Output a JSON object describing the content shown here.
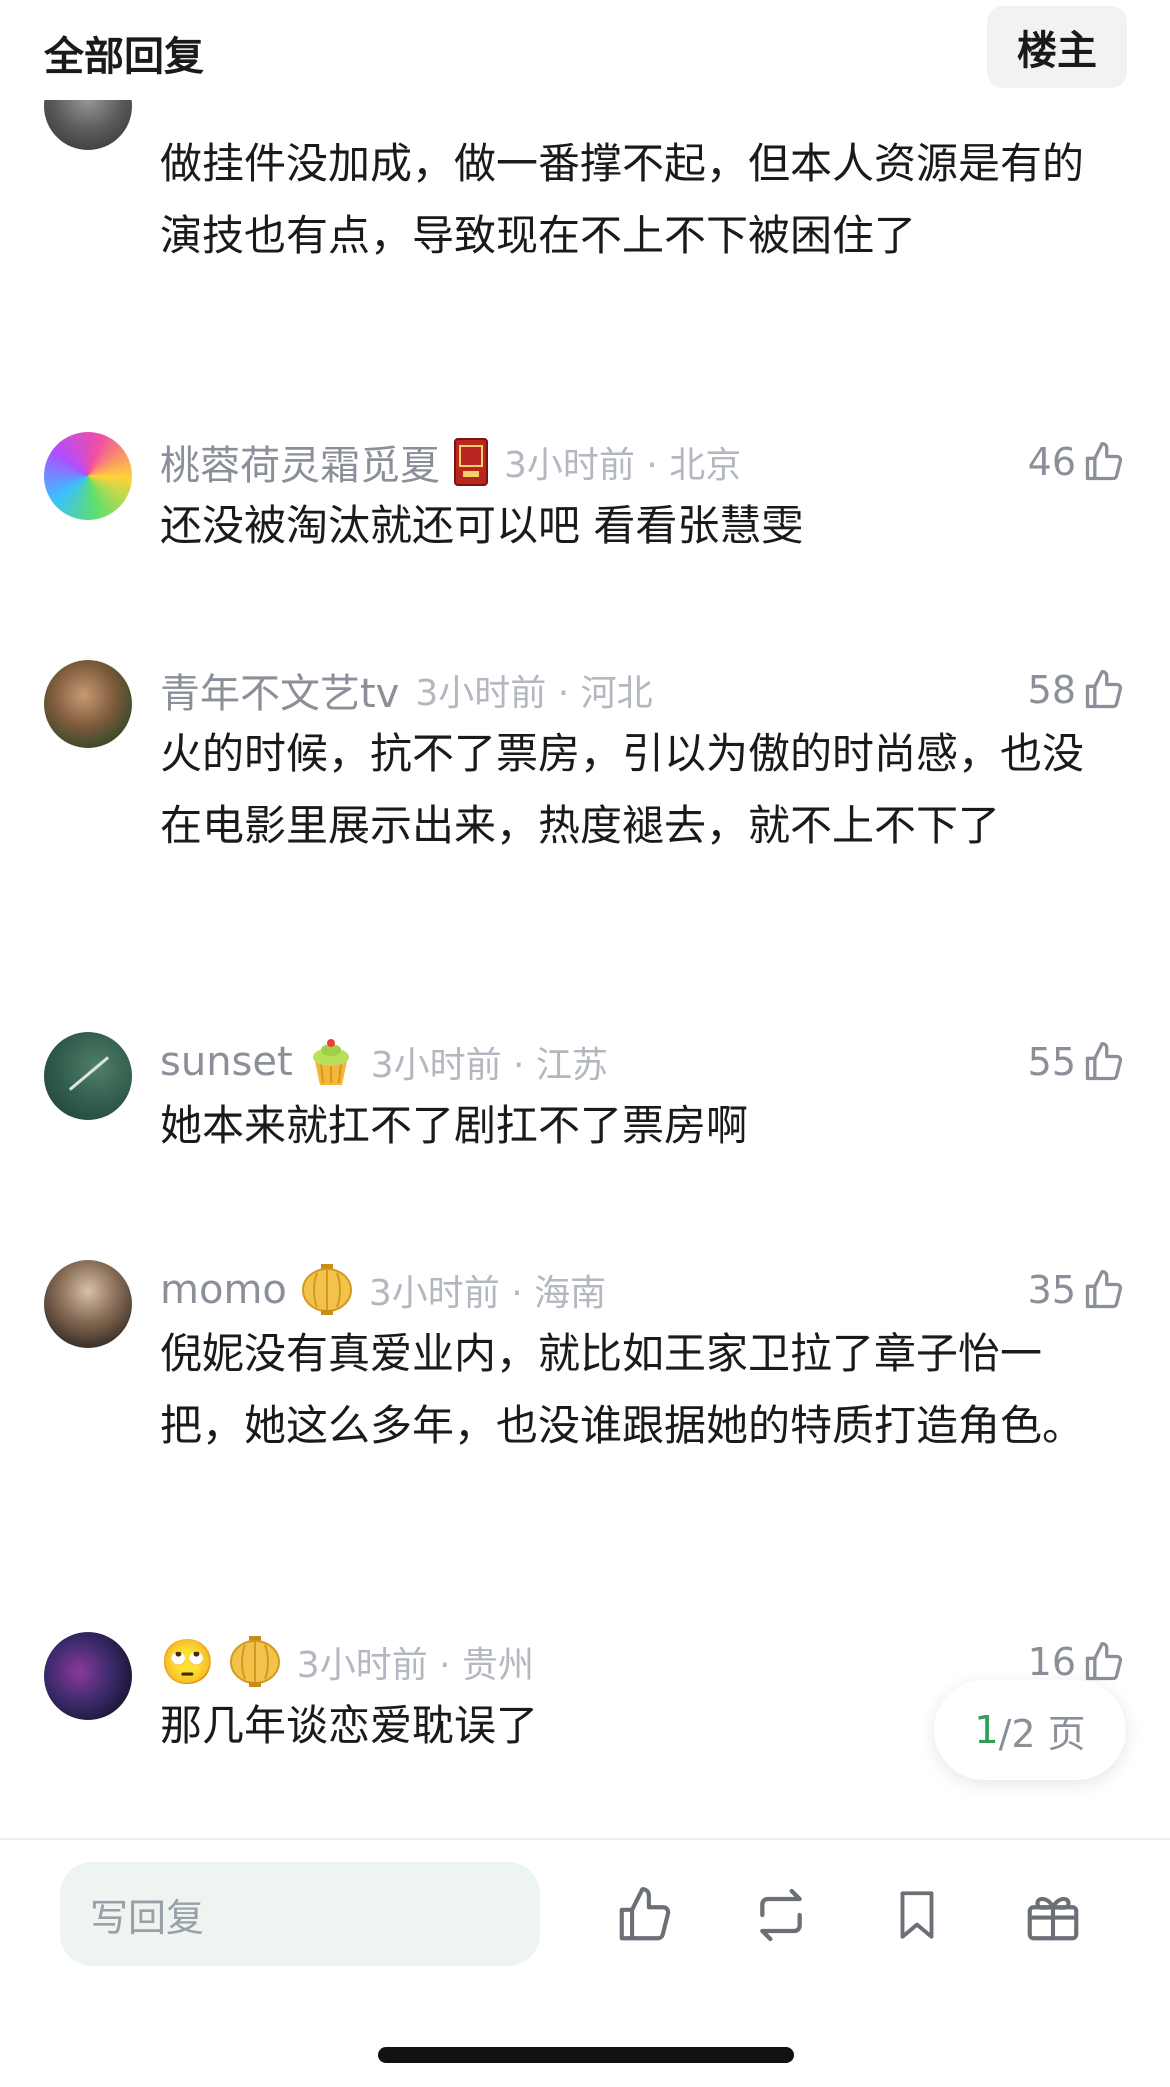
{
  "header": {
    "title": "全部回复",
    "op_label": "楼主"
  },
  "first_comment": {
    "text": "做挂件没加成，做一番撑不起，但本人资源是有的演技也有点，导致现在不上不下被困住了"
  },
  "comments": [
    {
      "username": "桃蓉荷灵霜觅夏",
      "badge": "book-badge-icon",
      "time_loc": "3小时前 · 北京",
      "likes": "46",
      "text": "还没被淘汰就还可以吧 看看张慧雯"
    },
    {
      "username": "青年不文艺tv",
      "badge": "",
      "time_loc": "3小时前 · 河北",
      "likes": "58",
      "text": "火的时候，抗不了票房，引以为傲的时尚感，也没在电影里展示出来，热度褪去，就不上不下了"
    },
    {
      "username": "sunset",
      "badge": "cupcake-badge-icon",
      "time_loc": "3小时前 · 江苏",
      "likes": "55",
      "text": "她本来就扛不了剧扛不了票房啊"
    },
    {
      "username": "momo",
      "badge": "lantern-badge-icon",
      "time_loc": "3小时前 · 海南",
      "likes": "35",
      "text": "倪妮没有真爱业内，就比如王家卫拉了章子怡一把，她这么多年，也没谁跟据她的特质打造角色。"
    },
    {
      "username": "🙄",
      "badge": "lantern-badge-icon",
      "time_loc": "3小时前 · 贵州",
      "likes": "16",
      "text": "那几年谈恋爱耽误了"
    }
  ],
  "pager": {
    "current": "1",
    "total_suffix": "/2 页"
  },
  "bottom_bar": {
    "reply_placeholder": "写回复",
    "icons": [
      "like-icon",
      "repost-icon",
      "bookmark-icon",
      "gift-icon"
    ]
  },
  "colors": {
    "accent_green": "#2e9e58",
    "meta_gray": "#8a8f99",
    "input_bg": "#eef4f0"
  }
}
